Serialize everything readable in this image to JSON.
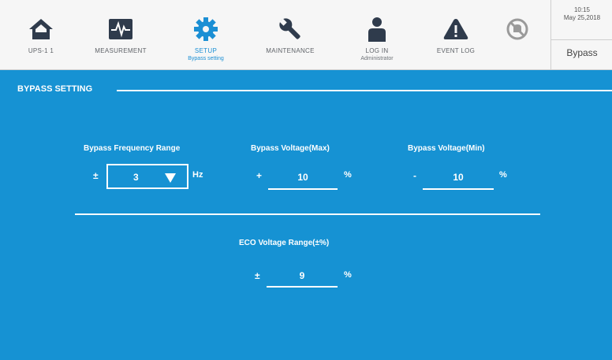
{
  "nav": {
    "items": [
      {
        "label": "UPS-1 1",
        "sub": "",
        "icon": "home-icon"
      },
      {
        "label": "MEASUREMENT",
        "sub": "",
        "icon": "measurement-icon"
      },
      {
        "label": "SETUP",
        "sub": "Bypass setting",
        "icon": "gear-icon"
      },
      {
        "label": "MAINTENANCE",
        "sub": "",
        "icon": "wrench-icon"
      },
      {
        "label": "LOG IN",
        "sub": "Administrator",
        "icon": "user-icon"
      },
      {
        "label": "EVENT LOG",
        "sub": "",
        "icon": "warning-icon"
      }
    ],
    "active_index": 2,
    "mute_icon": "alarm-mute-icon"
  },
  "status": {
    "time": "10:15",
    "date": "May 25,2018",
    "mode": "Bypass"
  },
  "section": {
    "title": "BYPASS SETTING"
  },
  "fields": {
    "freq": {
      "label": "Bypass Frequency Range",
      "sign": "±",
      "value": "3",
      "unit": "Hz"
    },
    "vmax": {
      "label": "Bypass Voltage(Max)",
      "sign": "+",
      "value": "10",
      "unit": "%"
    },
    "vmin": {
      "label": "Bypass Voltage(Min)",
      "sign": "-",
      "value": "10",
      "unit": "%"
    },
    "eco": {
      "label": "ECO Voltage Range(±%)",
      "sign": "±",
      "value": "9",
      "unit": "%"
    }
  },
  "colors": {
    "panel": "#1692d3",
    "icon": "#2f3b4c",
    "accent": "#1b8fd4"
  }
}
